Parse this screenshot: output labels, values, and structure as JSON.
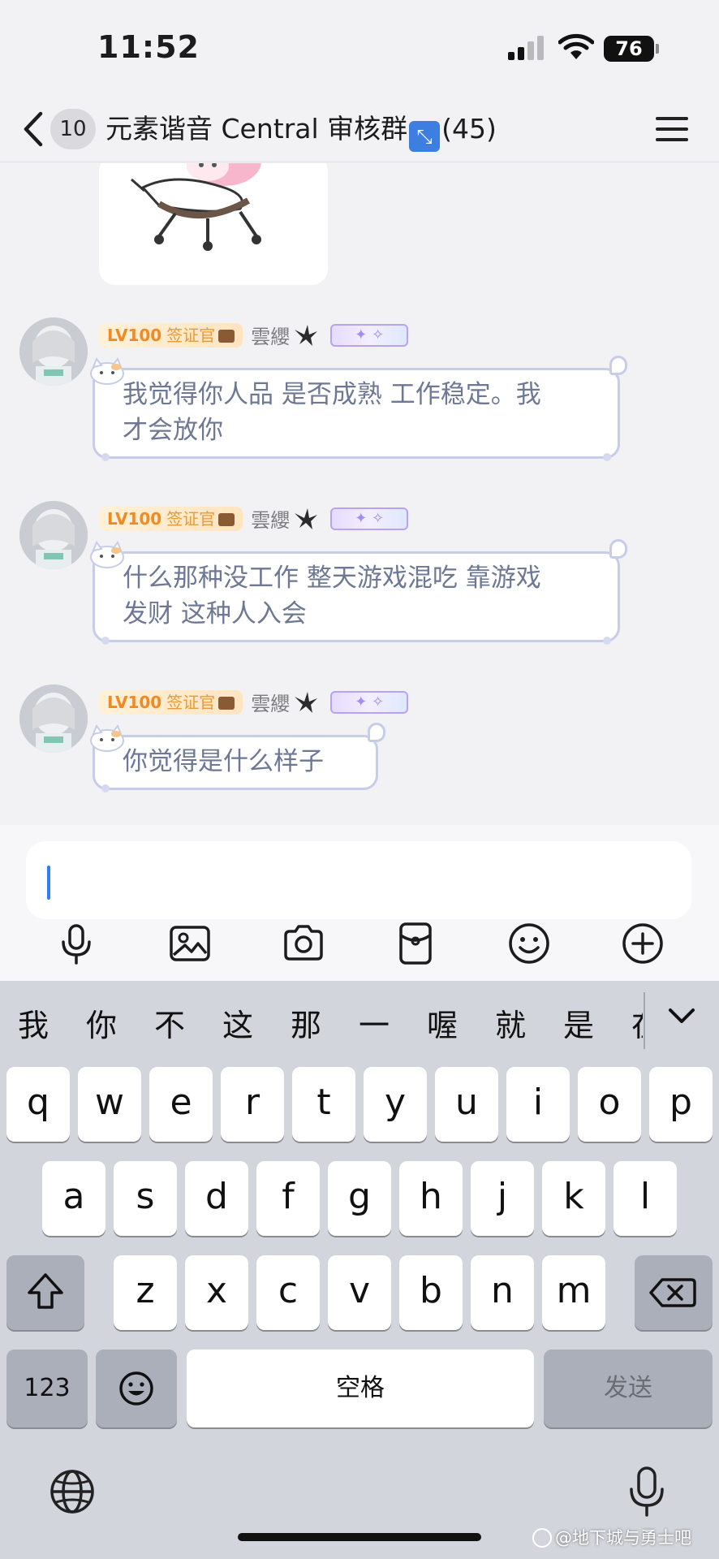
{
  "status_bar": {
    "time": "11:52",
    "battery": "76"
  },
  "nav": {
    "unread_count": "10",
    "title_prefix": "元素谐音 Central 审核群",
    "title_suffix": "(45)"
  },
  "messages": [
    {
      "level": "LV100",
      "title": "签证官",
      "nickname": "雲纓",
      "lines": [
        "我觉得你人品 是否成熟 工作稳定。我",
        "才会放你"
      ]
    },
    {
      "level": "LV100",
      "title": "签证官",
      "nickname": "雲纓",
      "lines": [
        "什么那种没工作 整天游戏混吃 靠游戏",
        "发财 这种人入会"
      ]
    },
    {
      "level": "LV100",
      "title": "签证官",
      "nickname": "雲纓",
      "lines": [
        "你觉得是什么样子"
      ]
    }
  ],
  "input": {
    "value": ""
  },
  "toolbar_icons": [
    "mic-icon",
    "image-icon",
    "camera-icon",
    "red-packet-icon",
    "emoji-icon",
    "plus-icon"
  ],
  "keyboard": {
    "candidates": [
      "我",
      "你",
      "不",
      "这",
      "那",
      "一",
      "喔",
      "就",
      "是",
      "在"
    ],
    "row1": [
      "q",
      "w",
      "e",
      "r",
      "t",
      "y",
      "u",
      "i",
      "o",
      "p"
    ],
    "row2": [
      "a",
      "s",
      "d",
      "f",
      "g",
      "h",
      "j",
      "k",
      "l"
    ],
    "row3": [
      "z",
      "x",
      "c",
      "v",
      "b",
      "n",
      "m"
    ],
    "num_label": "123",
    "space_label": "空格",
    "send_label": "发送"
  },
  "watermark": "@地下城与勇士吧",
  "colors": {
    "caret": "#2f7ef0",
    "bubble_border": "#c7cce8",
    "bubble_text": "#6e7894",
    "level_badge": "#f08a24"
  }
}
